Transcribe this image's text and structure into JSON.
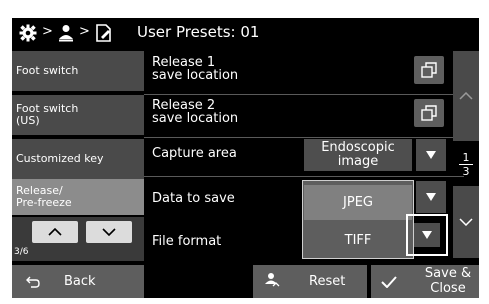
{
  "header": {
    "breadcrumb_icons": [
      "gear-icon",
      "user-icon",
      "document-icon"
    ],
    "separator": ">",
    "title": "User Presets: 01"
  },
  "nav": {
    "items": [
      {
        "label": "Foot switch"
      },
      {
        "label": "Foot switch\n(US)"
      },
      {
        "label": "Customized key"
      },
      {
        "label": "Release/\nPre-freeze"
      }
    ],
    "page_indicator": "3/6"
  },
  "rows": {
    "release1": {
      "label": "Release 1\nsave location"
    },
    "release2": {
      "label": "Release 2\nsave location"
    },
    "capture_area": {
      "label": "Capture area",
      "value": "Endoscopic\nimage"
    },
    "data_to_save": {
      "label": "Data to save"
    },
    "file_format": {
      "label": "File format"
    }
  },
  "dropdown_options": [
    "JPEG",
    "TIFF"
  ],
  "selected_option": "JPEG",
  "scroll": {
    "page_current": "1",
    "page_total": "3"
  },
  "footer": {
    "back_label": "Back",
    "reset_label": "Reset",
    "save_close_label": "Save &\nClose"
  },
  "colors": {
    "background": "#000000",
    "nav_item": "#4a4a4a",
    "nav_active": "#8c8c8c",
    "button": "#5e5e5e",
    "highlight": "#ffffff"
  }
}
